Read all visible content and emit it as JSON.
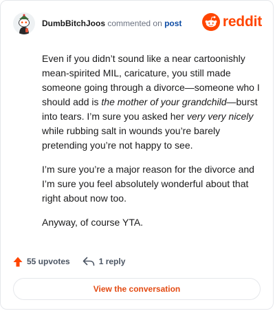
{
  "comment": {
    "username": "DumbBitchJoos",
    "action_text": "commented on",
    "post_link": "post",
    "brand": "reddit",
    "paragraphs": [
      [
        {
          "text": "Even if you didn’t sound like a near cartoonishly mean-spirited MIL, caricature, you still made someone going through a divorce—someone who I should add is "
        },
        {
          "text": "the mother of your grandchild",
          "em": true
        },
        {
          "text": "—burst into tears. I’m sure you asked her "
        },
        {
          "text": "very very nicely",
          "em": true
        },
        {
          "text": " while rubbing salt in wounds you’re barely pretending you’re not happy to see."
        }
      ],
      [
        {
          "text": "I’m sure you’re a major reason for the divorce and I’m sure you feel absolutely wonderful about that right about now too."
        }
      ],
      [
        {
          "text": "Anyway, of course YTA."
        }
      ]
    ]
  },
  "actions": {
    "upvotes": "55 upvotes",
    "replies": "1 reply"
  },
  "cta": {
    "label": "View the conversation"
  },
  "colors": {
    "brand": "#ff4500",
    "link": "#0e4ca4",
    "cta_text": "#e34a12"
  },
  "icons": {
    "avatar": "snoo-avatar-icon",
    "logo": "reddit-logo-icon",
    "upvote": "upvote-arrow-icon",
    "reply": "reply-arrow-icon"
  }
}
